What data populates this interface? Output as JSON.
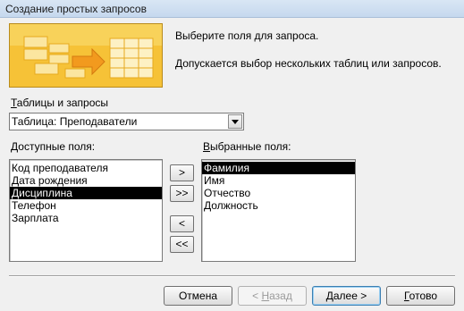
{
  "window": {
    "title": "Создание простых запросов"
  },
  "banner": {
    "icon": "query-wizard-illustration"
  },
  "description": {
    "line1": "Выберите поля для запроса.",
    "line2": "Допускается выбор нескольких таблиц или запросов."
  },
  "tables": {
    "label_first": "Т",
    "label_rest": "аблицы и запросы",
    "selected": "Таблица: Преподаватели"
  },
  "available": {
    "label_first": "Д",
    "label_rest": "оступные поля:",
    "items": [
      "Код преподавателя",
      "Дата рождения",
      "Дисциплина",
      "Телефон",
      "Зарплата"
    ],
    "selected_index": 2
  },
  "selected_fields": {
    "label_first": "В",
    "label_rest": "ыбранные поля:",
    "items": [
      "Фамилия",
      "Имя",
      "Отчество",
      "Должность"
    ],
    "selected_index": 0
  },
  "move_buttons": {
    "add_one": ">",
    "add_all": ">>",
    "remove_one": "<",
    "remove_all": "<<"
  },
  "buttons": {
    "cancel": "Отмена",
    "back_prefix": "< ",
    "back_u": "Н",
    "back_rest": "азад",
    "next_u": "Д",
    "next_rest": "алее >",
    "finish_u": "Г",
    "finish_rest": "отово"
  }
}
